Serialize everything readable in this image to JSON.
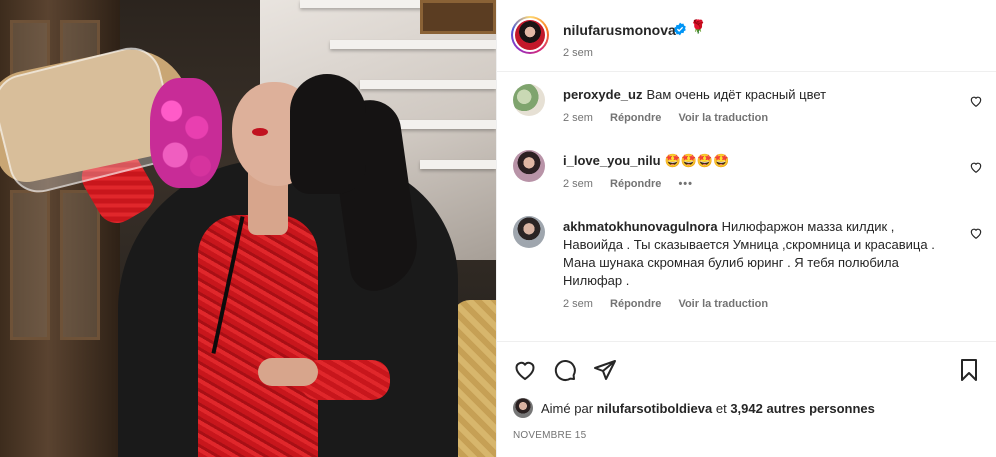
{
  "post": {
    "username": "nilufarusmonova",
    "rose_emoji": "🌹",
    "time": "2 sem"
  },
  "comments": [
    {
      "username": "peroxyde_uz",
      "text": "Вам очень идёт красный цвет",
      "time": "2 sem",
      "reply": "Répondre",
      "translate": "Voir la traduction"
    },
    {
      "username": "i_love_you_nilu",
      "text": "🤩🤩🤩🤩",
      "time": "2 sem",
      "reply": "Répondre",
      "more": "•••"
    },
    {
      "username": "akhmatokhunovagulnora",
      "text": "Нилюфаржон мазза килдик , Навоийда . Ты сказывается Умница ,скромница и красавица . Мана шунака скромная булиб юринг . Я тебя полюбила Нилюфар .",
      "time": "2 sem",
      "reply": "Répondre",
      "translate": "Voir la traduction"
    }
  ],
  "likes": {
    "prefix": "Aimé par",
    "user": "nilufarsotiboldieva",
    "middle": "et",
    "count": "3,942 autres personnes"
  },
  "date": "NOVEMBRE 15",
  "icons": [
    "heart-icon",
    "comment-icon",
    "share-icon",
    "bookmark-icon",
    "verified-badge-icon",
    "small-heart-icon"
  ],
  "colors": {
    "text": "#262626",
    "secondary": "#737373",
    "verified": "#0095f6",
    "border": "#efefef"
  }
}
